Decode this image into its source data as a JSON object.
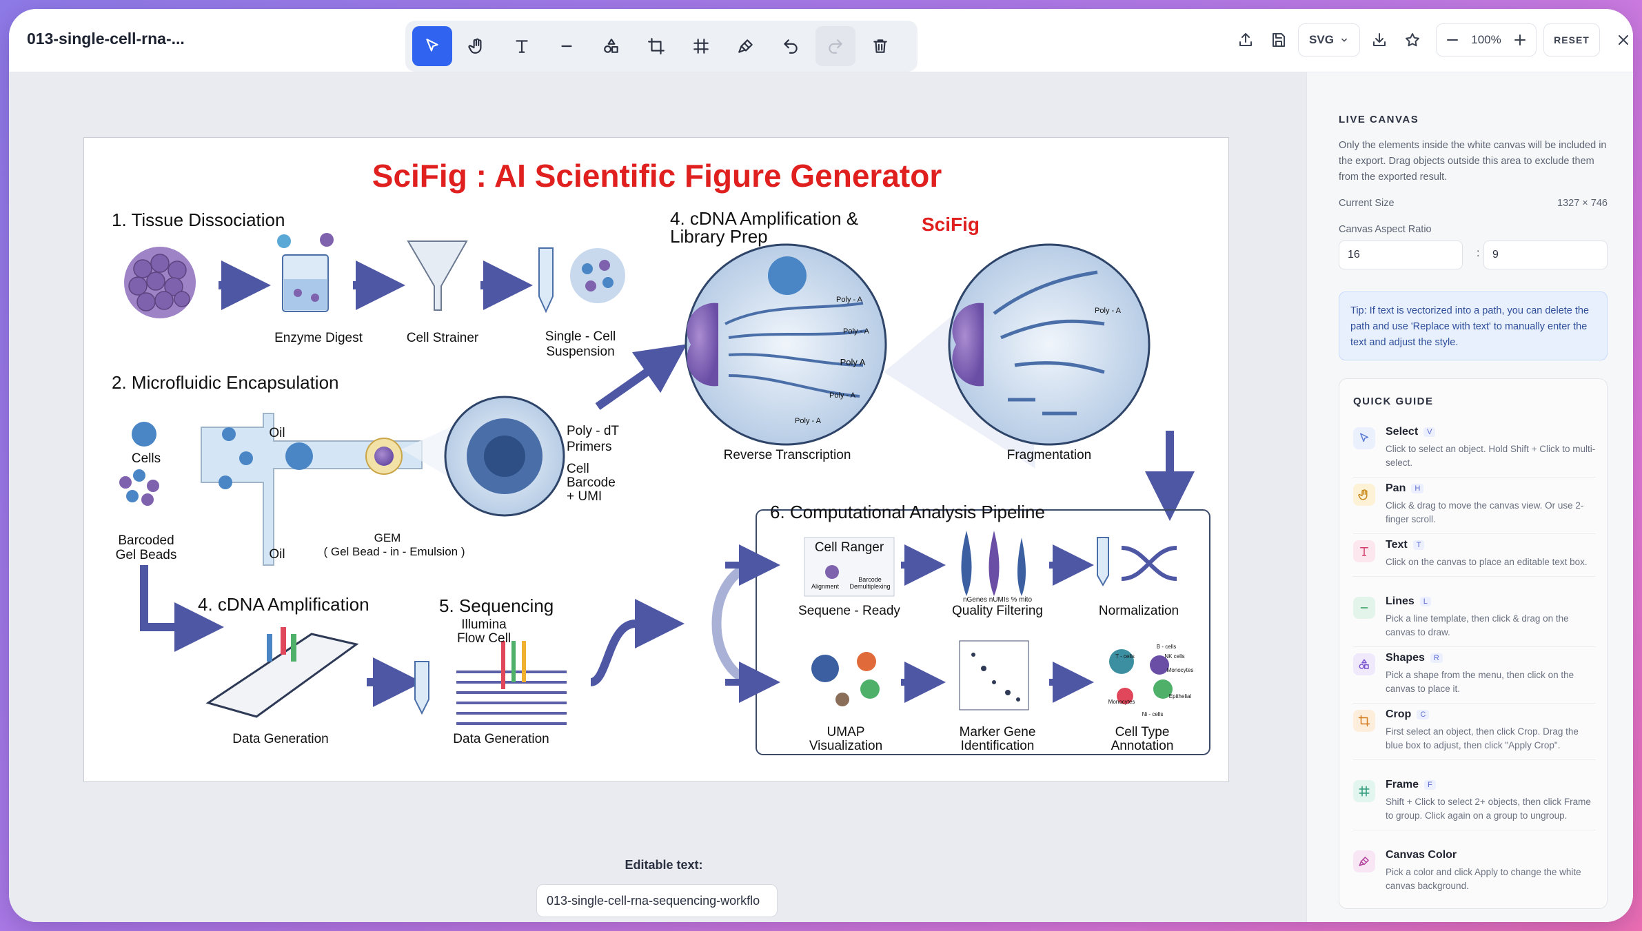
{
  "header": {
    "file_title": "013-single-cell-rna-...",
    "export_format": "SVG",
    "zoom": "100%",
    "reset_label": "RESET"
  },
  "toolbar": {
    "tools": [
      {
        "name": "select-tool",
        "icon": "cursor-icon",
        "active": true
      },
      {
        "name": "pan-tool",
        "icon": "hand-icon"
      },
      {
        "name": "text-tool",
        "icon": "text-icon"
      },
      {
        "name": "line-tool",
        "icon": "line-icon"
      },
      {
        "name": "shapes-tool",
        "icon": "shapes-icon"
      },
      {
        "name": "crop-tool",
        "icon": "crop-icon"
      },
      {
        "name": "frame-tool",
        "icon": "frame-icon"
      },
      {
        "name": "canvas-color-tool",
        "icon": "brush-icon"
      },
      {
        "name": "undo-button",
        "icon": "undo-icon"
      },
      {
        "name": "redo-button",
        "icon": "redo-icon",
        "disabled": true
      },
      {
        "name": "delete-button",
        "icon": "trash-icon"
      }
    ]
  },
  "figure": {
    "title": "SciFig : AI Scientific Figure Generator",
    "brand": "SciFig",
    "sections": {
      "s1": "1. Tissue Dissociation",
      "s2": "2. Microfluidic Encapsulation",
      "s3": "4. cDNA Amplification & Library Prep",
      "s4": "4. cDNA Amplification",
      "s5": "5. Sequencing",
      "s6": "6. Computational Analysis Pipeline"
    },
    "labels": {
      "enzyme": "Enzyme Digest",
      "strainer": "Cell Strainer",
      "single_cell": "Single - Cell",
      "suspension": "Suspension",
      "cells": "Cells",
      "beads1": "Barcoded",
      "beads2": "Gel Beads",
      "oil_top": "Oil",
      "oil_bot": "Oil",
      "gem": "GEM",
      "gem2": "( Gel Bead - in - Emulsion )",
      "polydt1": "Poly - dT",
      "polydt2": "Primers",
      "barcode1": "Cell",
      "barcode2": "Barcode",
      "barcode3": "+ UMI",
      "rt": "Reverse Transcription",
      "frag": "Fragmentation",
      "datagen1": "Data Generation",
      "datagen2": "Data Generation",
      "illumina1": "Illumina",
      "illumina2": "Flow Cell",
      "cellranger": "Cell Ranger",
      "seqready": "Sequene - Ready",
      "qc": "Quality Filtering",
      "norm": "Normalization",
      "umap1": "UMAP",
      "umap2": "Visualization",
      "marker1": "Marker Gene",
      "marker2": "Identification",
      "annot1": "Cell Type",
      "annot2": "Annotation",
      "polya": "Poly - A",
      "polya2": "Poly A",
      "alignment": "Alignment",
      "barcode_demux1": "Barcode",
      "barcode_demux2": "Demultiplexing",
      "qc_axis": "nGenes nUMIs % mito",
      "tcells": "T - cells",
      "nkcells": "NK cells",
      "bcells": "B - cells",
      "monocytes": "Monocytes",
      "monocytes2": "Monocytes",
      "epithelial": "Epithelial",
      "nicells": "Ni - cells"
    }
  },
  "editable": {
    "label": "Editable text:",
    "value": "013-single-cell-rna-sequencing-workflo"
  },
  "panel": {
    "title": "LIVE CANVAS",
    "description": "Only the elements inside the white canvas will be included in the export. Drag objects outside this area to exclude them from the exported result.",
    "current_size_label": "Current Size",
    "current_size_value": "1327 × 746",
    "aspect_label": "Canvas Aspect Ratio",
    "aspect_w": "16",
    "aspect_h": "9",
    "tip": "Tip: If text is vectorized into a path, you can delete the path and use 'Replace with text' to manually enter the text and adjust the style.",
    "guide_title": "QUICK GUIDE",
    "guide": [
      {
        "name": "Select",
        "key": "V",
        "desc": "Click to select an object. Hold Shift + Click to multi-select.",
        "icon": "cursor-icon",
        "color": "#5b7bd6",
        "bg": "#eaf0fc"
      },
      {
        "name": "Pan",
        "key": "H",
        "desc": "Click & drag to move the canvas view. Or use 2-finger scroll.",
        "icon": "hand-icon",
        "color": "#c98a1e",
        "bg": "#fdf1d6"
      },
      {
        "name": "Text",
        "key": "T",
        "desc": "Click on the canvas to place an editable text box.",
        "icon": "text-icon",
        "color": "#d43a6a",
        "bg": "#fde7ee"
      },
      {
        "name": "Lines",
        "key": "L",
        "desc": "Pick a line template, then click & drag on the canvas to draw.",
        "icon": "line-icon",
        "color": "#2e9a5a",
        "bg": "#e3f5ea"
      },
      {
        "name": "Shapes",
        "key": "R",
        "desc": "Pick a shape from the menu, then click on the canvas to place it.",
        "icon": "shapes-icon",
        "color": "#7a54d0",
        "bg": "#efe9fb"
      },
      {
        "name": "Crop",
        "key": "C",
        "desc": "First select an object, then click Crop. Drag the blue box to adjust, then click \"Apply Crop\".",
        "icon": "crop-icon",
        "color": "#d27a1c",
        "bg": "#fdeedc"
      },
      {
        "name": "Frame",
        "key": "F",
        "desc": "Shift + Click to select 2+ objects, then click Frame to group. Click again on a group to ungroup.",
        "icon": "frame-icon",
        "color": "#2e9a7a",
        "bg": "#e2f5ef"
      },
      {
        "name": "Canvas Color",
        "key": "",
        "desc": "Pick a color and click Apply to change the white canvas background.",
        "icon": "brush-icon",
        "color": "#b2409c",
        "bg": "#f8e6f4"
      }
    ]
  }
}
